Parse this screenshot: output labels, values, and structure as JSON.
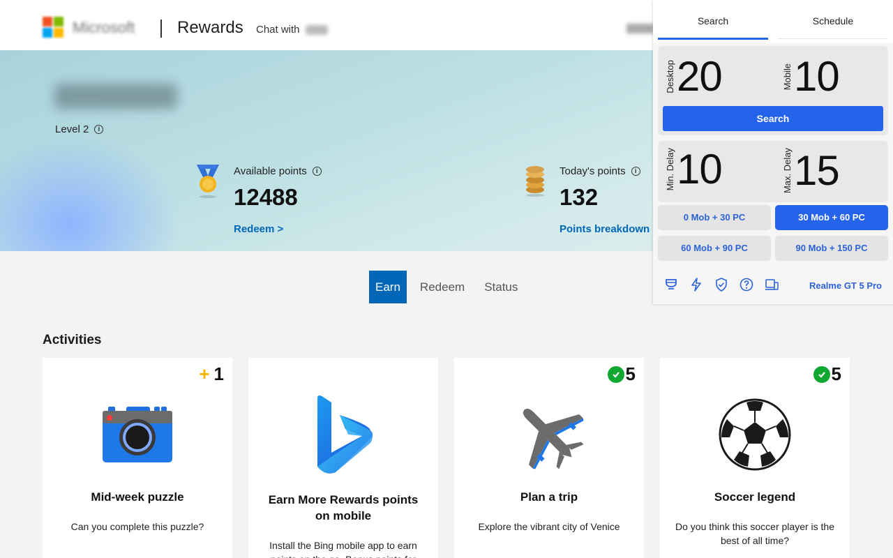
{
  "header": {
    "brand": "Microsoft",
    "title": "Rewards",
    "chat_label": "Chat with"
  },
  "hero": {
    "level_label": "Level 2",
    "available_label": "Available points",
    "available_value": "12488",
    "redeem_link": "Redeem >",
    "today_label": "Today's points",
    "today_value": "132",
    "breakdown_link": "Points breakdown"
  },
  "tabs": [
    {
      "label": "Earn",
      "active": true
    },
    {
      "label": "Redeem",
      "active": false
    },
    {
      "label": "Status",
      "active": false
    }
  ],
  "activities": {
    "heading": "Activities",
    "cards": [
      {
        "badge": "1",
        "badge_type": "plus",
        "title": "Mid-week puzzle",
        "desc": "Can you complete this puzzle?",
        "icon": "camera-icon"
      },
      {
        "badge": "",
        "badge_type": "none",
        "title": "Earn More Rewards points on mobile",
        "desc": "Install the Bing mobile app to earn points on the go. Bonus points for",
        "icon": "bing-logo-icon"
      },
      {
        "badge": "5",
        "badge_type": "check",
        "title": "Plan a trip",
        "desc": "Explore the vibrant city of Venice",
        "icon": "airplane-icon"
      },
      {
        "badge": "5",
        "badge_type": "check",
        "title": "Soccer legend",
        "desc": "Do you think this soccer player is the best of all time?",
        "icon": "soccer-ball-icon"
      }
    ]
  },
  "popup": {
    "tabs": [
      "Search",
      "Schedule"
    ],
    "desktop_label": "Desktop",
    "desktop_value": "20",
    "mobile_label": "Mobile",
    "mobile_value": "10",
    "search_button": "Search",
    "min_delay_label": "Min. Delay",
    "min_delay_value": "10",
    "max_delay_label": "Max. Delay",
    "max_delay_value": "15",
    "presets": [
      "0 Mob + 30 PC",
      "30 Mob + 60 PC",
      "60 Mob + 90 PC",
      "90 Mob + 150 PC"
    ],
    "active_preset": "30 Mob + 60 PC",
    "footer_icons": [
      "cup-icon",
      "lightning-icon",
      "shield-check-icon",
      "help-icon",
      "devices-icon"
    ],
    "device_name": "Realme GT 5 Pro",
    "accent": "#2563eb"
  }
}
